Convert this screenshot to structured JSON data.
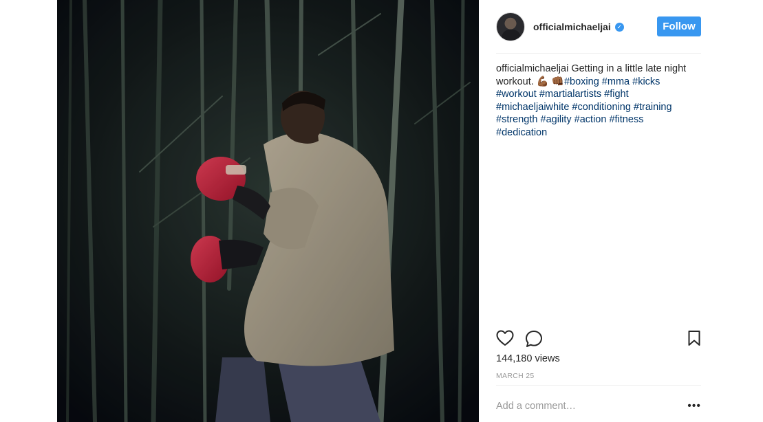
{
  "post": {
    "image_alt": "Man in tan t-shirt wearing red boxing gloves throwing punches at night in a bamboo grove",
    "author": {
      "username": "officialmichaeljai",
      "verified_icon": "verified-badge-icon",
      "verified_glyph": "✓"
    },
    "follow_label": "Follow",
    "caption": {
      "username": "officialmichaeljai",
      "text_before_tags": " Getting in a little late night workout. 💪🏾 👊🏾",
      "hashtags": [
        "#boxing",
        "#mma",
        "#kicks",
        "#workout",
        "#martialartists",
        "#fight",
        "#michaeljaiwhite",
        "#conditioning",
        "#training",
        "#strength",
        "#agility",
        "#action",
        "#fitness",
        "#dedication"
      ]
    },
    "actions": {
      "like_icon": "heart-icon",
      "comment_icon": "comment-bubble-icon",
      "save_icon": "bookmark-icon"
    },
    "views": "144,180 views",
    "date": "MARCH 25",
    "comment_placeholder": "Add a comment…",
    "more_label": "•••"
  },
  "colors": {
    "accent": "#3897f0",
    "hashtag": "#003569",
    "muted": "#999999",
    "text": "#262626"
  }
}
